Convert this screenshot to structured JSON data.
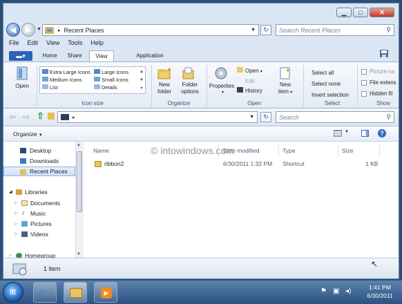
{
  "window": {
    "caption_buttons": {
      "minimize": "▁",
      "maximize": "□",
      "close": "✕"
    }
  },
  "nav": {
    "back_icon": "arrow-left-icon",
    "address_path": "Recent Places",
    "search_placeholder": "Search Recent Places"
  },
  "menu": [
    "File",
    "Edit",
    "View",
    "Tools",
    "Help"
  ],
  "ribbon": {
    "tabs": [
      "Home",
      "Share",
      "View",
      "Application"
    ],
    "active_tab": "View",
    "open_label": "Open",
    "layout_options": {
      "col1": [
        "Extra Large Icons",
        "Medium Icons",
        "List"
      ],
      "col2": [
        "Large Icons",
        "Small Icons",
        "Details"
      ]
    },
    "new_folder_line1": "New",
    "new_folder_line2": "folder",
    "folder_options_line1": "Folder",
    "folder_options_line2": "options",
    "properties_label": "Properties",
    "open_small": "Open",
    "edit_small": "Edit",
    "history_small": "History",
    "new_item_line1": "New",
    "new_item_line2": "item",
    "select_all": "Select all",
    "select_none": "Select none",
    "invert_selection": "Invert selection",
    "checkboxes": [
      "Picture na",
      "File extens",
      "Hidden fil"
    ],
    "groups": [
      "Icon size",
      "Organize",
      "Open",
      "Select",
      "Show"
    ]
  },
  "toolbar2": {
    "search_placeholder": "Search"
  },
  "cmdbar": {
    "organize_label": "Organize"
  },
  "navpane": {
    "items": [
      {
        "label": "Desktop"
      },
      {
        "label": "Downloads"
      },
      {
        "label": "Recent Places"
      },
      {
        "label": "Libraries"
      },
      {
        "label": "Documents"
      },
      {
        "label": "Music"
      },
      {
        "label": "Pictures"
      },
      {
        "label": "Videos"
      },
      {
        "label": "Homegroup"
      }
    ]
  },
  "content": {
    "columns": [
      "Name",
      "Date modified",
      "Type",
      "Size"
    ],
    "rows": [
      {
        "name": "ribbon2",
        "date": "6/30/2011 1:32 PM",
        "type": "Shortcut",
        "size": "1 KB"
      }
    ]
  },
  "watermark": "© intowindows.com",
  "status": {
    "count": "1 item"
  },
  "taskbar": {
    "time": "1:41 PM",
    "date": "6/30/2011"
  },
  "colors": {
    "accent": "#2a63b8",
    "window_bg": "#dbe6f4",
    "taskbar": "#3b6390"
  }
}
